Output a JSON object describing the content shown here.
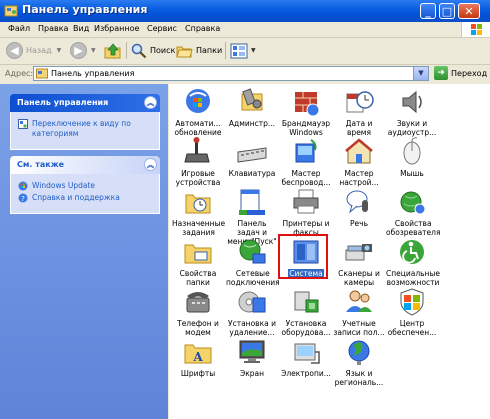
{
  "window": {
    "title": "Панель управления"
  },
  "menu": [
    "Файл",
    "Правка",
    "Вид",
    "Избранное",
    "Сервис",
    "Справка"
  ],
  "toolbar": {
    "back": "Назад",
    "search": "Поиск",
    "folders": "Папки"
  },
  "address": {
    "label": "Адрес:",
    "value": "Панель управления",
    "go": "Переход"
  },
  "left": {
    "panel_title": "Панель управления",
    "switch_link": "Переключение к виду по категориям",
    "see_also_title": "См. также",
    "see_also": [
      "Windows Update",
      "Справка и поддержка"
    ]
  },
  "items": [
    {
      "label": "Автомати... обновление",
      "icon": "automatic-updates-icon"
    },
    {
      "label": "Админстр...",
      "icon": "administrative-tools-icon"
    },
    {
      "label": "Брандмауэр Windows",
      "icon": "windows-firewall-icon"
    },
    {
      "label": "Дата и время",
      "icon": "date-time-icon"
    },
    {
      "label": "Звуки и аудиоустр...",
      "icon": "sounds-audio-icon"
    },
    {
      "label": "Игровые устройства",
      "icon": "game-controllers-icon"
    },
    {
      "label": "Клавиатура",
      "icon": "keyboard-icon"
    },
    {
      "label": "Мастер беспровод...",
      "icon": "wireless-wizard-icon"
    },
    {
      "label": "Мастер настрой...",
      "icon": "network-setup-wizard-icon"
    },
    {
      "label": "Мышь",
      "icon": "mouse-icon"
    },
    {
      "label": "Назначенные задания",
      "icon": "scheduled-tasks-icon"
    },
    {
      "label": "Панель задач и меню \"Пуск\"",
      "icon": "taskbar-start-menu-icon"
    },
    {
      "label": "Принтеры и факсы",
      "icon": "printers-faxes-icon"
    },
    {
      "label": "Речь",
      "icon": "speech-icon"
    },
    {
      "label": "Свойства обозревателя",
      "icon": "internet-options-icon"
    },
    {
      "label": "Свойства папки",
      "icon": "folder-options-icon"
    },
    {
      "label": "Сетевые подключения",
      "icon": "network-connections-icon"
    },
    {
      "label": "Система",
      "icon": "system-icon"
    },
    {
      "label": "Сканеры и камеры",
      "icon": "scanners-cameras-icon"
    },
    {
      "label": "Специальные возможности",
      "icon": "accessibility-options-icon"
    },
    {
      "label": "Телефон и модем",
      "icon": "phone-modem-icon"
    },
    {
      "label": "Установка и удаление...",
      "icon": "add-remove-programs-icon"
    },
    {
      "label": "Установка оборудова...",
      "icon": "add-hardware-icon"
    },
    {
      "label": "Учетные записи пол...",
      "icon": "user-accounts-icon"
    },
    {
      "label": "Центр обеспечен...",
      "icon": "security-center-icon"
    },
    {
      "label": "Шрифты",
      "icon": "fonts-icon"
    },
    {
      "label": "Экран",
      "icon": "display-icon"
    },
    {
      "label": "Электропи...",
      "icon": "power-options-icon"
    },
    {
      "label": "Язык и региональ...",
      "icon": "regional-language-icon"
    }
  ],
  "selected_item": "Система",
  "colors": {
    "title_bar": "#0a5fe0",
    "left_pane": "#6a8fe0",
    "selection": "#316ac5",
    "highlight_box": "#e01010"
  }
}
